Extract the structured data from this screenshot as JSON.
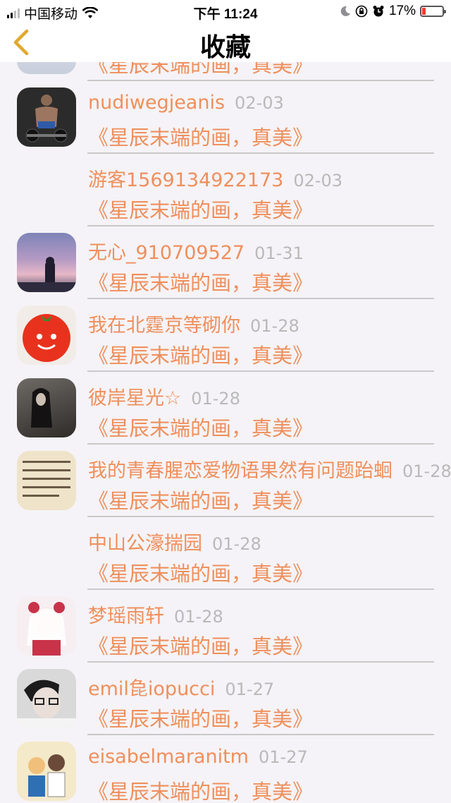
{
  "status_bar": {
    "carrier": "中国移动",
    "time": "下午 11:24",
    "battery": "17%"
  },
  "nav": {
    "title": "收藏"
  },
  "items": [
    {
      "name": "",
      "date": "",
      "text": "《星辰末端的画，真美》"
    },
    {
      "name": "nudiwegjeanis",
      "date": "02-03",
      "text": "《星辰末端的画，真美》"
    },
    {
      "name": "游客1569134922173",
      "date": "02-03",
      "text": "《星辰末端的画，真美》"
    },
    {
      "name": "无心_910709527",
      "date": "01-31",
      "text": "《星辰末端的画，真美》"
    },
    {
      "name": "我在北霆京等砌你",
      "date": "01-28",
      "text": "《星辰末端的画，真美》"
    },
    {
      "name": "彼岸星光☆",
      "date": "01-28",
      "text": "《星辰末端的画，真美》"
    },
    {
      "name": "我的青春腥恋爱物语果然有问题跆蛔",
      "date": "01-28",
      "text": "《星辰末端的画，真美》"
    },
    {
      "name": "中山公濠揣园",
      "date": "01-28",
      "text": "《星辰末端的画，真美》"
    },
    {
      "name": "梦瑶雨轩",
      "date": "01-28",
      "text": "《星辰末端的画，真美》"
    },
    {
      "name": "emil㲋iopucci",
      "date": "01-27",
      "text": "《星辰末端的画，真美》"
    },
    {
      "name": "eisabelmaranitm",
      "date": "01-27",
      "text": "《星辰末端的画，真美》"
    }
  ]
}
